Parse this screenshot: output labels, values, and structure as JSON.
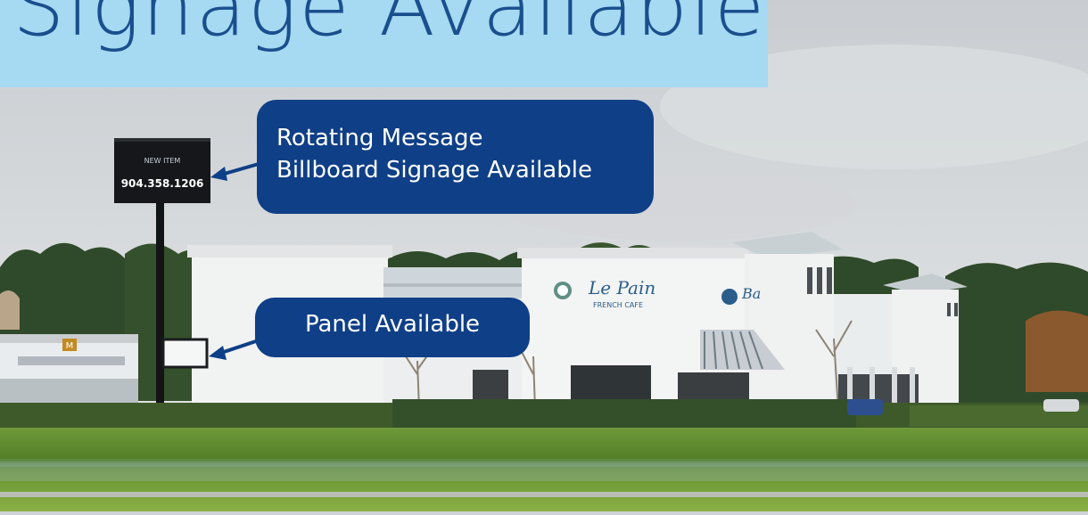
{
  "title": {
    "text": "Signage Available"
  },
  "callouts": {
    "billboard_line1": "Rotating Message",
    "billboard_line2": "Billboard Signage Available",
    "panel": "Panel Available"
  },
  "billboard": {
    "phone": "904.358.1206"
  },
  "colors": {
    "banner": "#a6d9f2",
    "title": "#1a4f8e",
    "callout": "#0f3f86"
  }
}
